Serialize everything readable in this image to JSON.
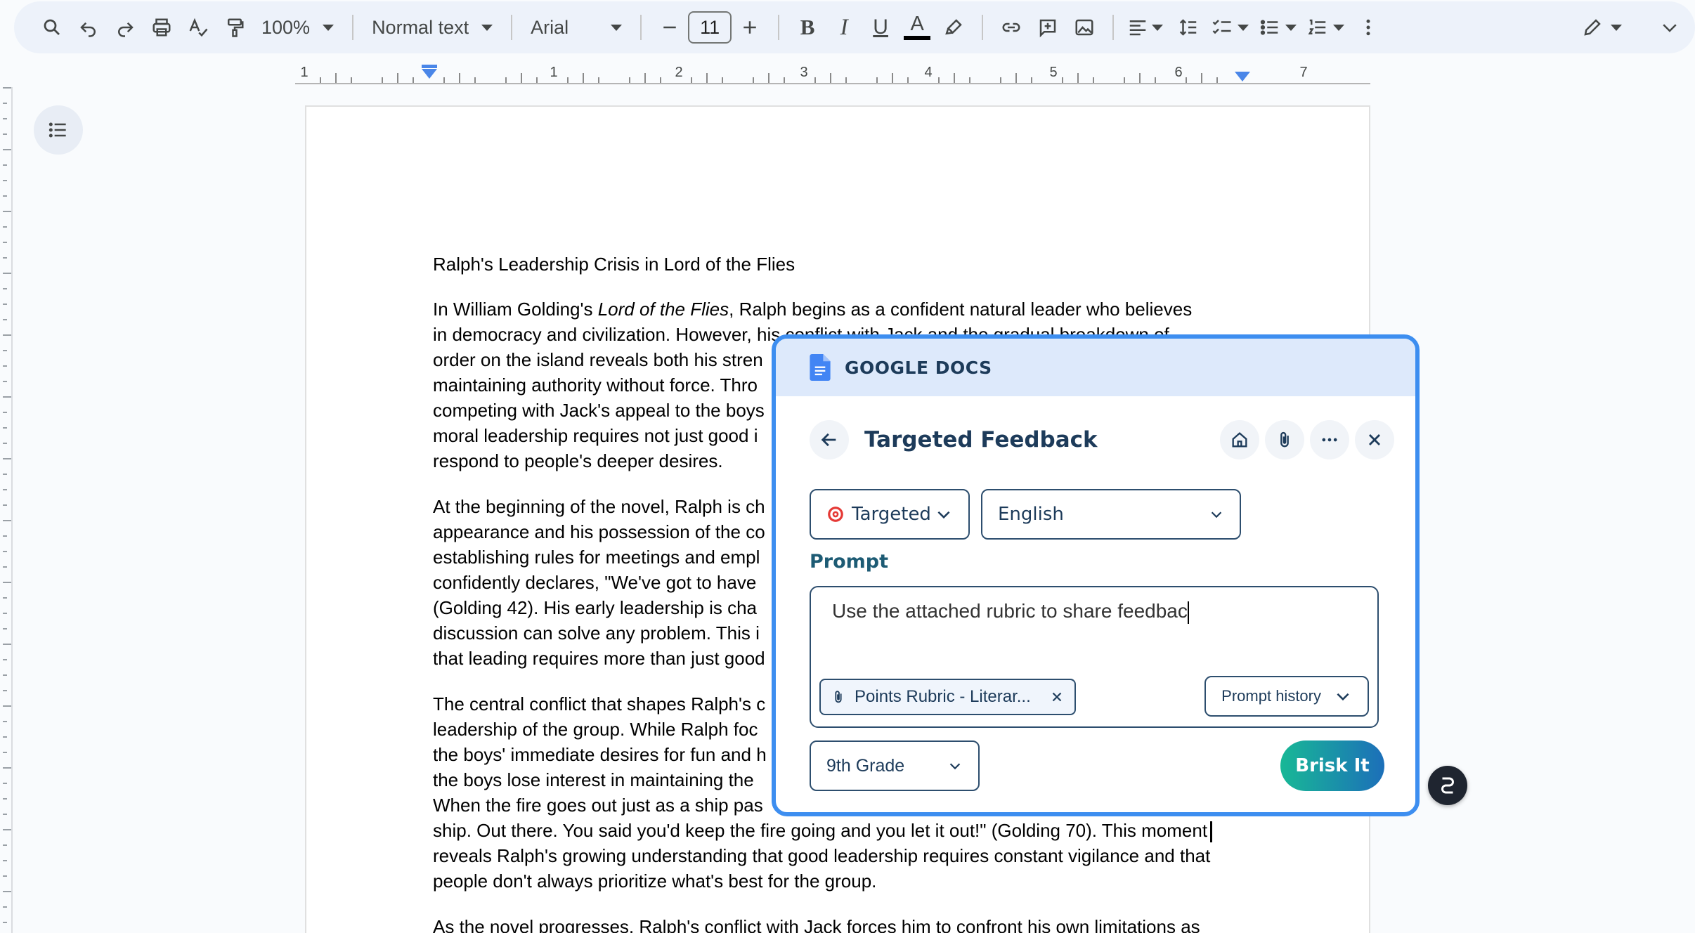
{
  "toolbar": {
    "zoom": "100%",
    "style": "Normal text",
    "font": "Arial",
    "font_size": "11",
    "bold": "B",
    "italic": "I",
    "underline": "U",
    "text_color": "A",
    "text_color_hex": "#000000"
  },
  "ruler": {
    "labels": [
      "1",
      "1",
      "2",
      "3",
      "4",
      "5",
      "6",
      "7"
    ]
  },
  "document": {
    "title": "Ralph's Leadership Crisis in Lord of the Flies",
    "p1_before": "In William Golding's ",
    "p1_italic": "Lord of the Flies",
    "p1_line1_rest": ", Ralph begins as a confident natural leader who believes",
    "p1_lines": "in democracy and civilization. However, his conflict with Jack and the gradual breakdown of\norder on the island reveals both his stren\nmaintaining authority without force. Thro\ncompeting with Jack's appeal to the boys\nmoral leadership requires not just good i\nrespond to people's deeper desires.",
    "p2": "At the beginning of the novel, Ralph is ch\nappearance and his possession of the co\nestablishing rules for meetings and empl\nconfidently declares, \"We've got to have\n(Golding 42). His early leadership is cha\ndiscussion can solve any problem. This i\nthat leading requires more than just good",
    "p3": "The central conflict that shapes Ralph's c\nleadership of the group. While Ralph foc\nthe boys' immediate desires for fun and h\nthe boys lose interest in maintaining the\nWhen the fire goes out just as a ship pas\nship. Out there. You said you'd keep the fire going and you let it out!\" (Golding 70). This moment",
    "p3_rest": "reveals Ralph's growing understanding that good leadership requires constant vigilance and that\npeople don't always prioritize what's best for the group.",
    "p4": "As the novel progresses, Ralph's conflict with Jack forces him to confront his own limitations as"
  },
  "panel": {
    "brand": "GOOGLE DOCS",
    "title": "Targeted Feedback",
    "mode_select": "Targeted",
    "language_select": "English",
    "prompt_label": "Prompt",
    "prompt_value": "Use the attached rubric to share feedbac",
    "attachment": "Points Rubric - Literar...",
    "history_button": "Prompt history",
    "grade_select": "9th Grade",
    "submit_button": "Brisk It",
    "accent_color": "#3d8ef0"
  }
}
